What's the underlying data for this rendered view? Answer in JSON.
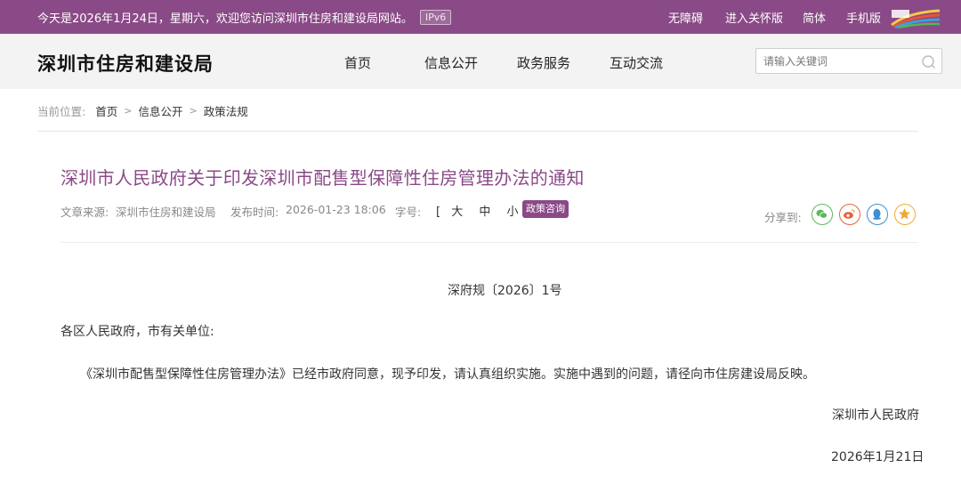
{
  "topbar": {
    "welcome": "今天是2026年1月24日，星期六，欢迎您访问深圳市住房和建设局网站。",
    "ipv6": "IPv6",
    "links": [
      "无障碍",
      "进入关怀版",
      "简体",
      "手机版"
    ]
  },
  "header": {
    "site_title": "深圳市住房和建设局",
    "nav": [
      "首页",
      "信息公开",
      "政务服务",
      "互动交流"
    ],
    "search_placeholder": "请输入关键词"
  },
  "breadcrumb": {
    "label": "当前位置:",
    "items": [
      "首页",
      "信息公开",
      "政策法规"
    ],
    "separator": ">"
  },
  "article": {
    "title": "深圳市人民政府关于印发深圳市配售型保障性住房管理办法的通知",
    "source_label": "文章来源:",
    "source": "深圳市住房和建设局",
    "time_label": "发布时间:",
    "time": "2026-01-23 18:06",
    "fontsize_label": "字号:",
    "fontsize_open": "[",
    "fontsize_options": [
      "大",
      "中",
      "小"
    ],
    "fontsize_close": "]",
    "tag": "政策咨询",
    "share_label": "分享到:",
    "share_icons": [
      "wechat-icon",
      "weibo-icon",
      "qq-icon",
      "favorite-icon"
    ],
    "doc_number": "深府规〔2026〕1号",
    "salutation": "各区人民政府，市有关单位:",
    "paragraph": "《深圳市配售型保障性住房管理办法》已经市政府同意，现予印发，请认真组织实施。实施中遇到的问题，请径向市住房建设局反映。",
    "signature": "深圳市人民政府",
    "date": "2026年1月21日"
  },
  "colors": {
    "brand_purple": "#8a4a87",
    "header_bg": "#f3f3f3",
    "wechat": "#5cb85c",
    "weibo": "#e8623a",
    "qq": "#3a8fd6",
    "favorite": "#f0a830"
  }
}
